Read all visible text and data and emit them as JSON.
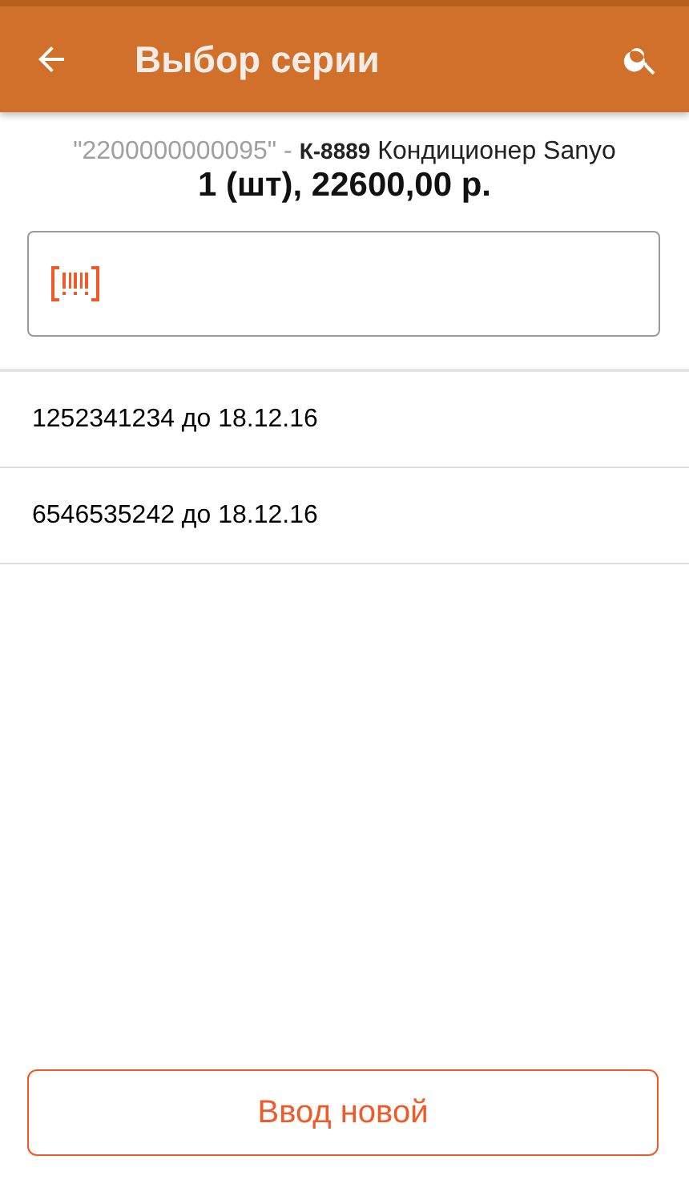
{
  "app_bar": {
    "title": "Выбор серии"
  },
  "product": {
    "barcode": "\"2200000000095\" -",
    "article": "К-8889",
    "name": "Кондиционер Sanyo",
    "summary": "1 (шт), 22600,00 р."
  },
  "series": [
    {
      "label": "1252341234 до 18.12.16"
    },
    {
      "label": "6546535242 до 18.12.16"
    }
  ],
  "buttons": [
    "Ввод новой"
  ]
}
